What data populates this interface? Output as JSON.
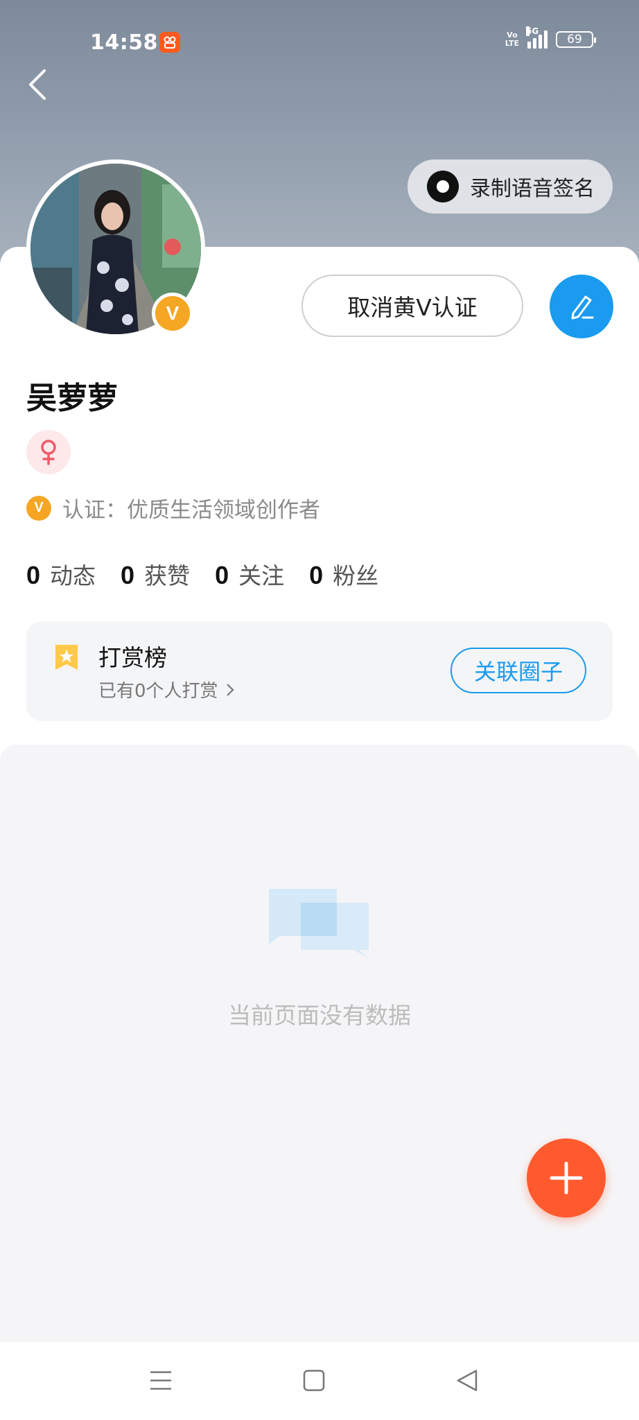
{
  "status_bar": {
    "time": "14:58",
    "network": "5G",
    "volte": "Vo\nLTE",
    "battery": "69"
  },
  "header": {
    "voice_sign_label": "录制语音签名"
  },
  "profile": {
    "cancel_v_label": "取消黄V认证",
    "v_badge": "V",
    "name": "吴萝萝",
    "verify_text": "认证：优质生活领域创作者",
    "stats": [
      {
        "num": "0",
        "label": "动态"
      },
      {
        "num": "0",
        "label": "获赞"
      },
      {
        "num": "0",
        "label": "关注"
      },
      {
        "num": "0",
        "label": "粉丝"
      }
    ]
  },
  "reward": {
    "title": "打赏榜",
    "subtitle": "已有0个人打赏",
    "link_button": "关联圈子"
  },
  "feed": {
    "empty_text": "当前页面没有数据"
  },
  "colors": {
    "accent_blue": "#1a9bef",
    "fab_orange": "#ff5a2e",
    "v_gold": "#f5a623"
  },
  "icons": {
    "back": "chevron-left-icon",
    "edit": "pencil-icon",
    "gender": "female-icon",
    "reward": "bookmark-star-icon",
    "empty": "chat-bubbles-icon",
    "fab": "plus-icon"
  }
}
